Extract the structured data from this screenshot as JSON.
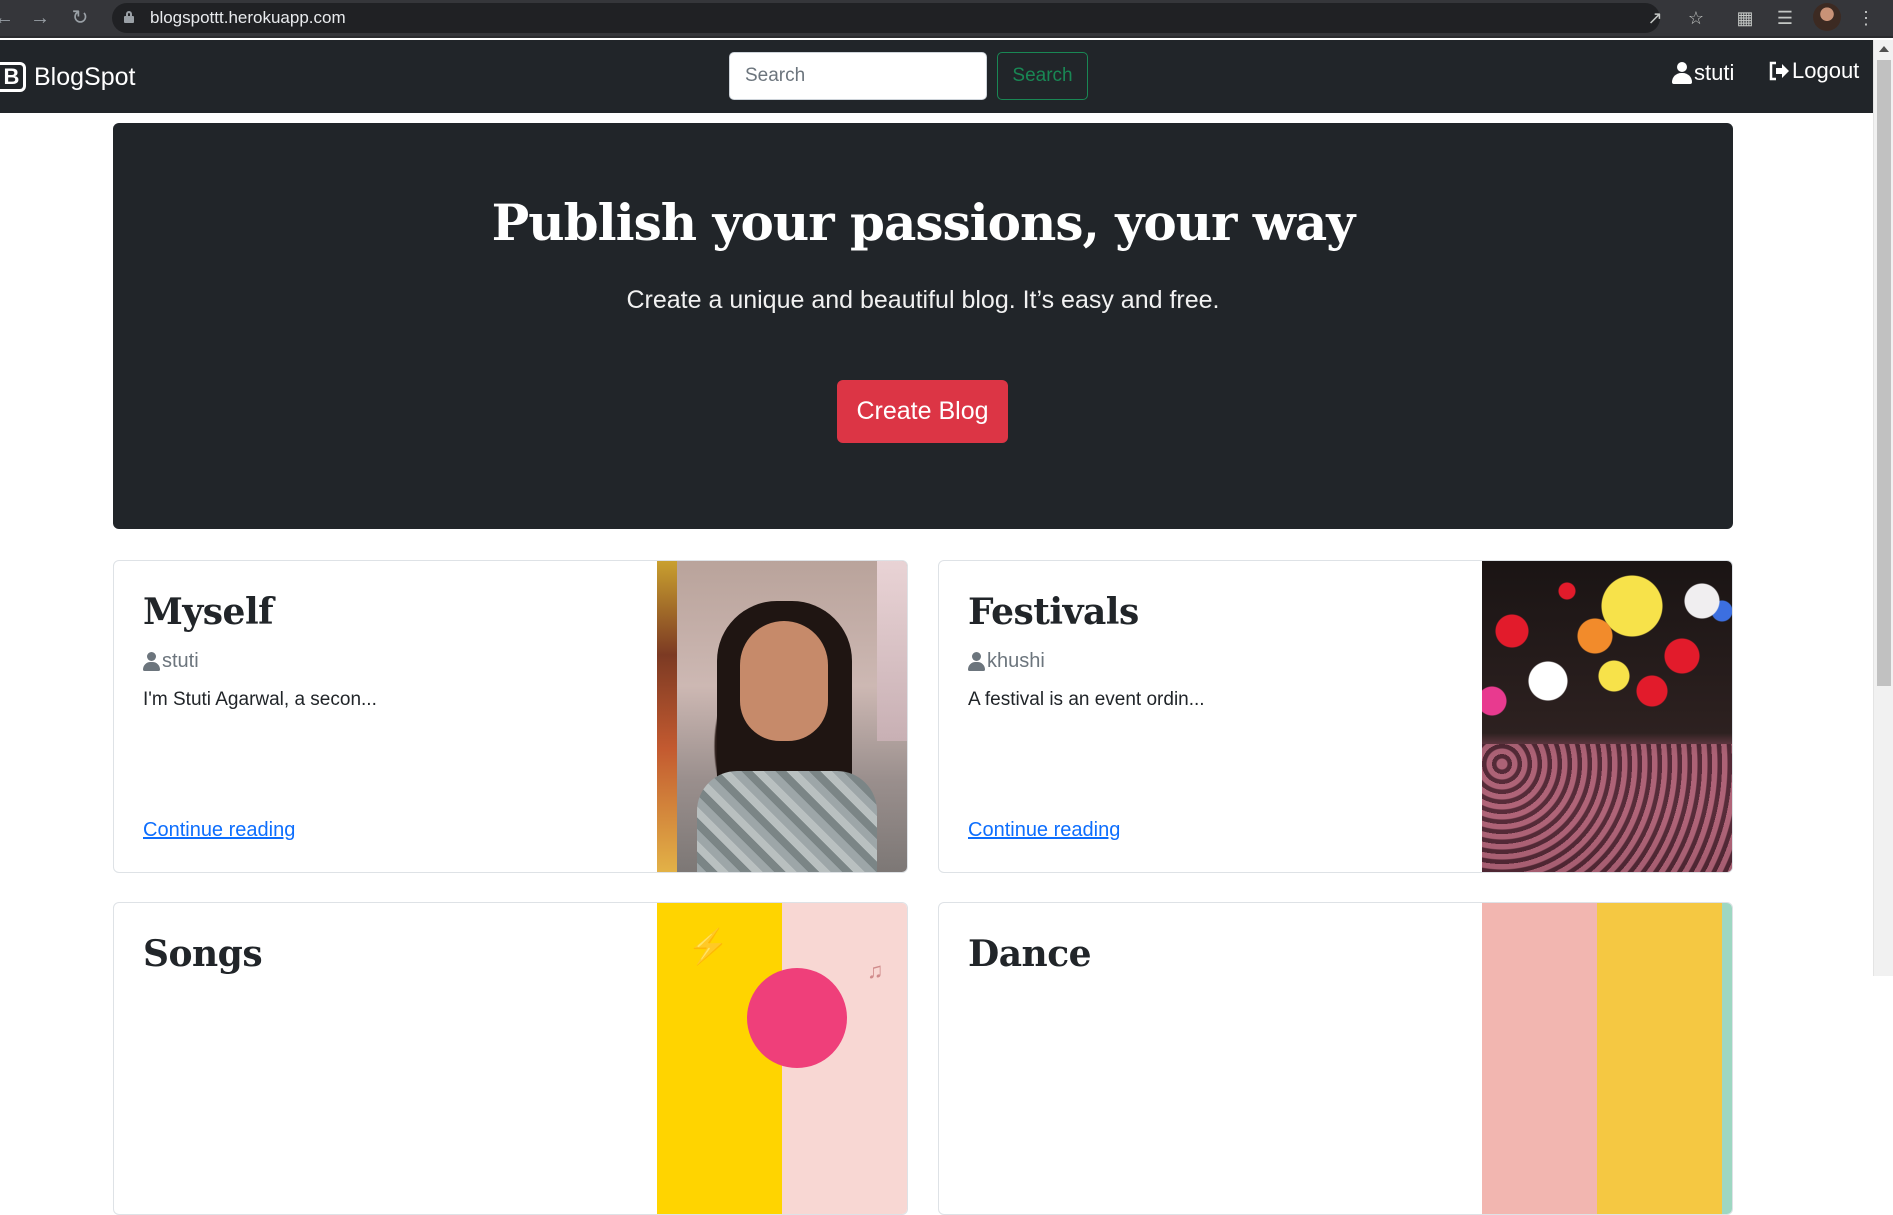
{
  "browser": {
    "url": "blogspottt.herokuapp.com"
  },
  "navbar": {
    "brand": "BlogSpot",
    "brand_logo_letter": "B",
    "search_placeholder": "Search",
    "search_button": "Search",
    "user_name": "stuti",
    "logout_label": "Logout"
  },
  "hero": {
    "title": "Publish your passions, your way",
    "subtitle": "Create a unique and beautiful blog. It’s easy and free.",
    "cta": "Create Blog"
  },
  "posts": [
    {
      "title": "Myself",
      "author": "stuti",
      "excerpt": "I'm Stuti Agarwal, a secon...",
      "link": "Continue reading"
    },
    {
      "title": "Festivals",
      "author": "khushi",
      "excerpt": "A festival is an event ordin...",
      "link": "Continue reading"
    },
    {
      "title": "Songs"
    },
    {
      "title": "Dance"
    }
  ],
  "colors": {
    "navbar_bg": "#212529",
    "hero_bg": "#212529",
    "cta_bg": "#dc3545",
    "search_button": "#198754",
    "link": "#0d6efd"
  }
}
